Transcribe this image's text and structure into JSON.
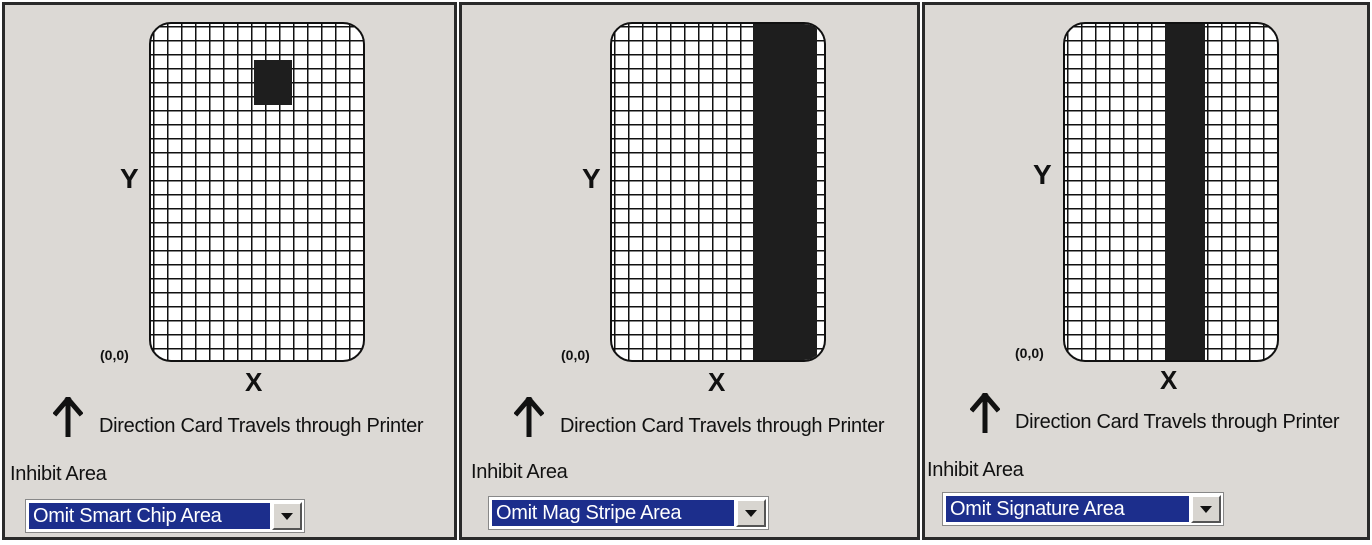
{
  "axis": {
    "y_label": "Y",
    "x_label": "X",
    "origin_label": "(0,0)"
  },
  "direction_text": "Direction Card Travels through Printer",
  "inhibit_label": "Inhibit Area",
  "panels": [
    {
      "selected_option": "Omit Smart Chip Area"
    },
    {
      "selected_option": "Omit Mag Stripe Area"
    },
    {
      "selected_option": "Omit Signature Area"
    }
  ],
  "icons": [
    "up-arrow-icon",
    "dropdown-arrow-icon"
  ],
  "colors": {
    "panel_bg": "#dcd9d5",
    "selection_bg": "#1c2e8c",
    "inhibit_fill": "#1e1e1e"
  }
}
